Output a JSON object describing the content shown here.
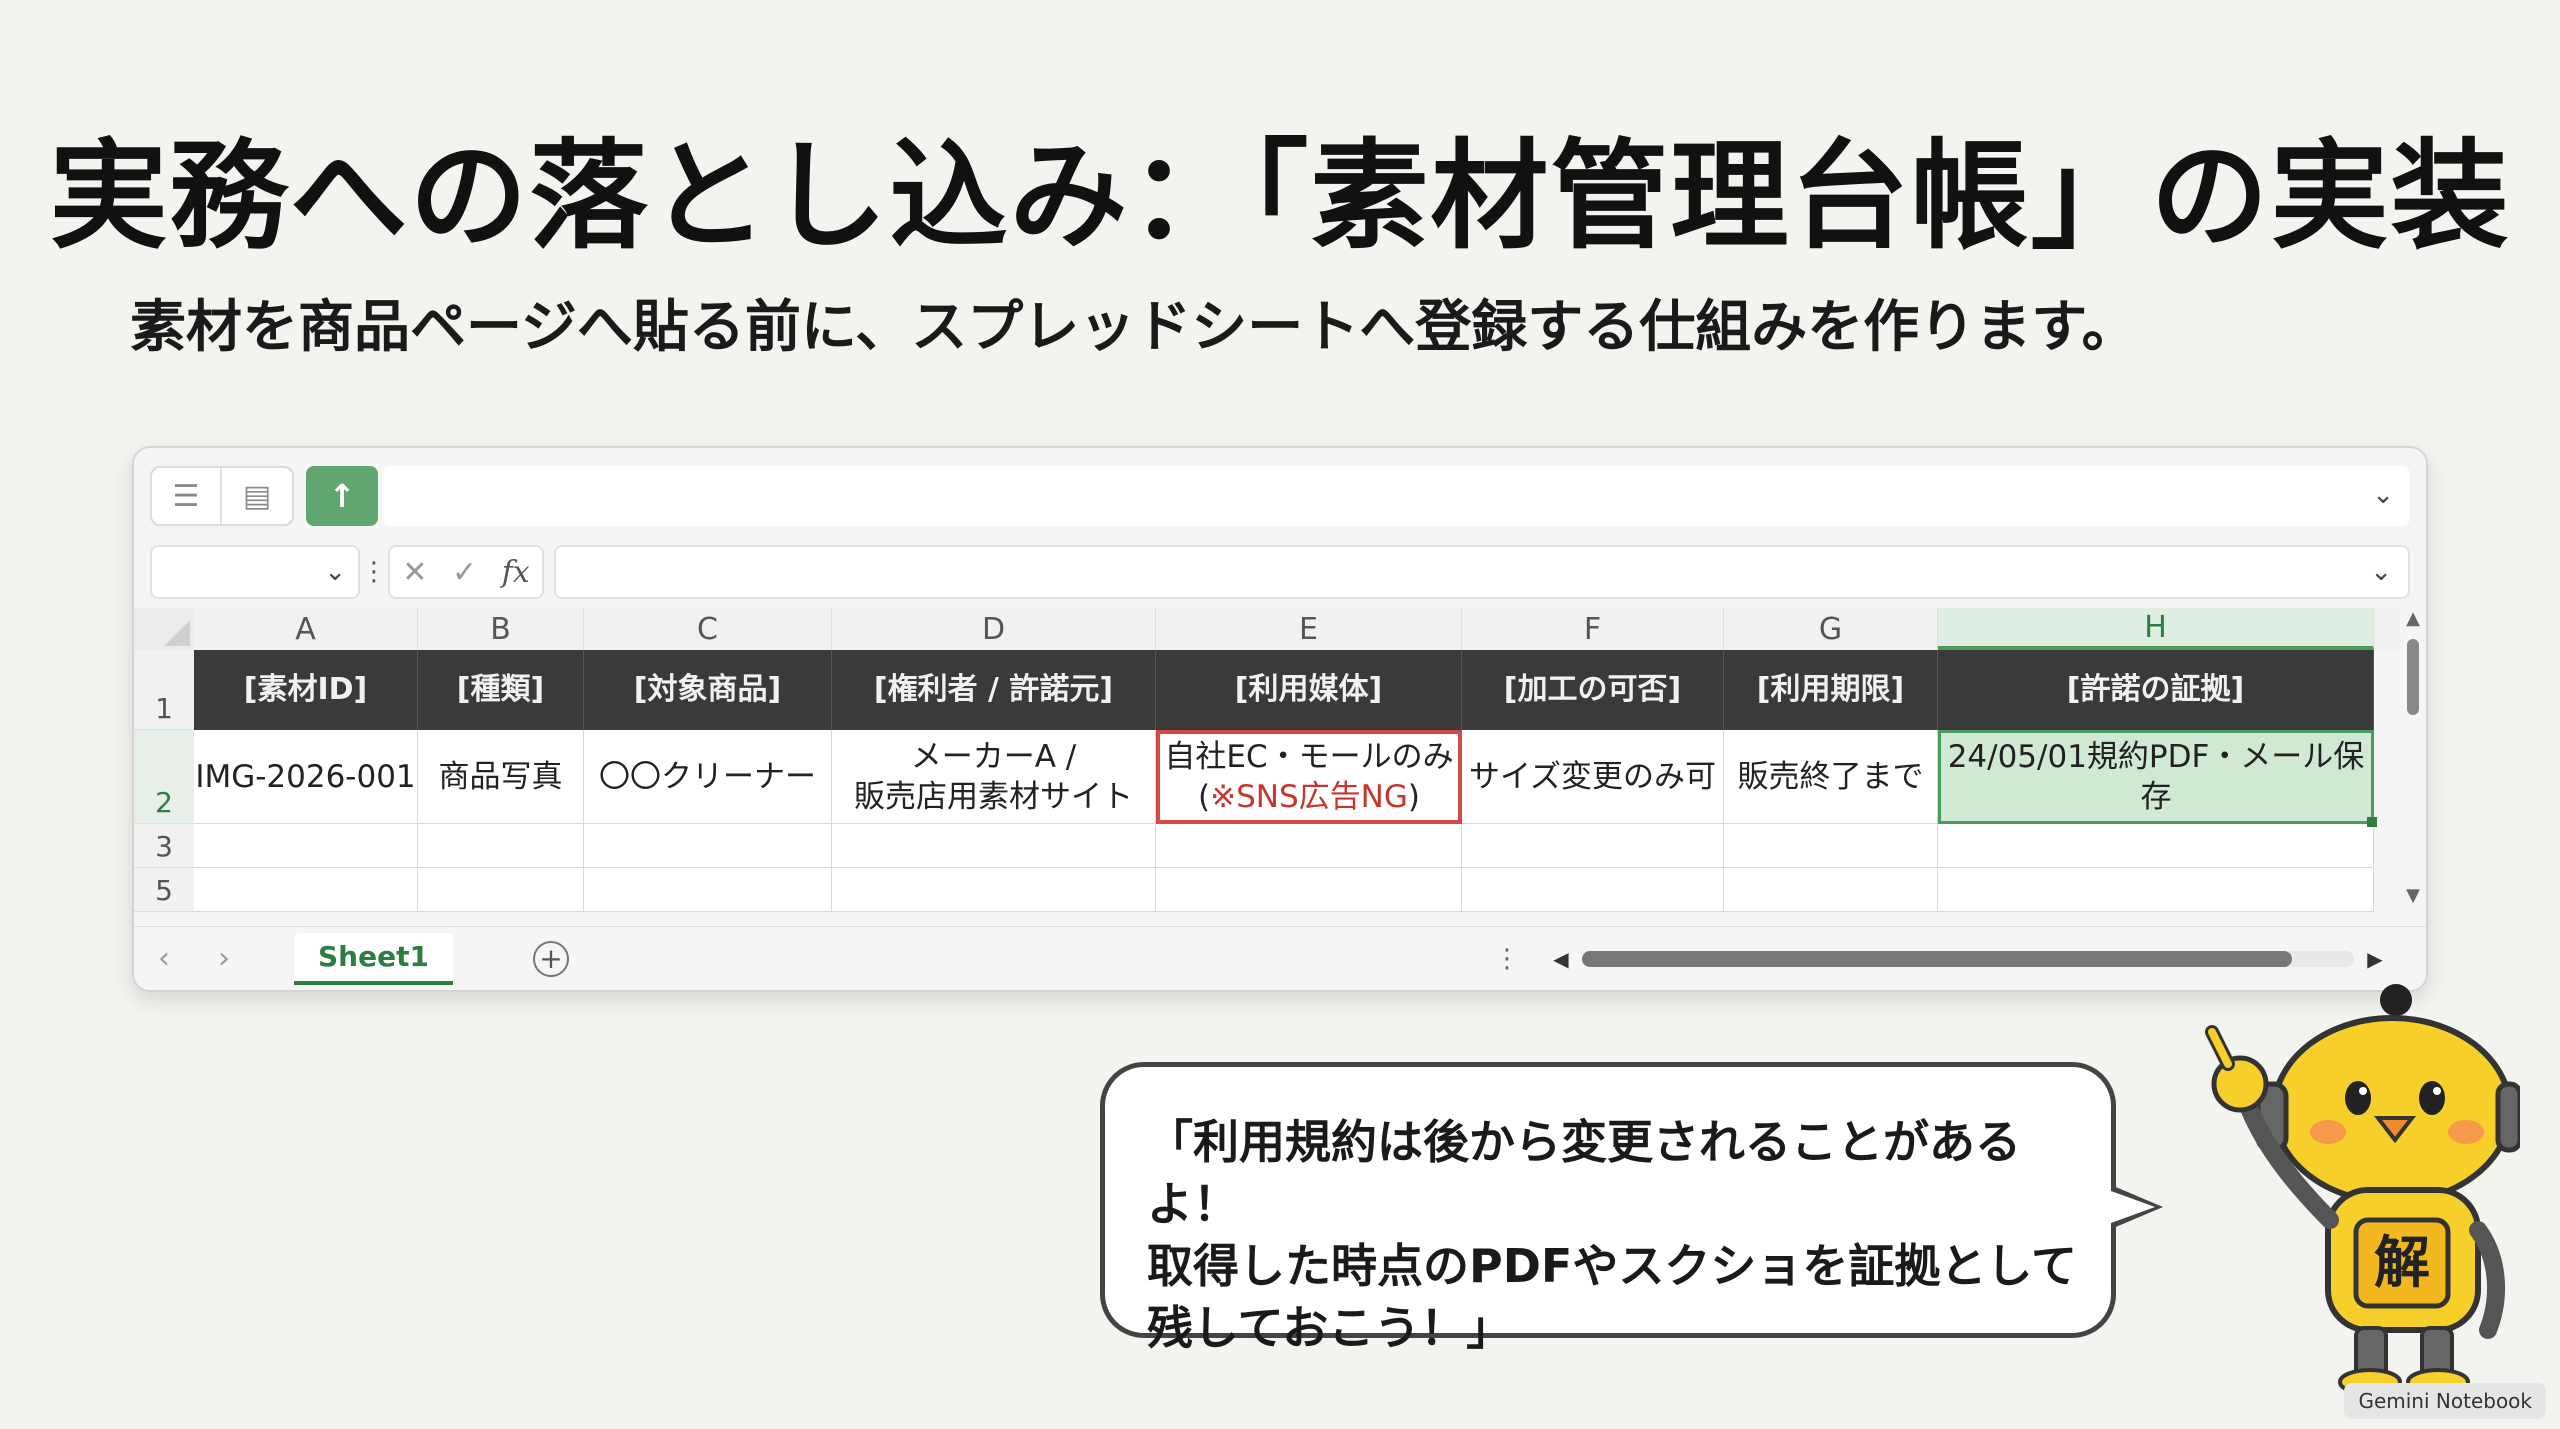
{
  "title": "実務への落とし込み：「素材管理台帳」の実装",
  "subtitle": "素材を商品ページへ貼る前に、スプレッドシートへ登録する仕組みを作ります。",
  "spreadsheet": {
    "toolbar": {
      "upload_icon": "↑"
    },
    "formula_bar": {
      "fx_label": "fx"
    },
    "columns": [
      "A",
      "B",
      "C",
      "D",
      "E",
      "F",
      "G",
      "H"
    ],
    "selected_column": "H",
    "headers": [
      "[素材ID]",
      "[種類]",
      "[対象商品]",
      "[権利者 / 許諾元]",
      "[利用媒体]",
      "[加工の可否]",
      "[利用期限]",
      "[許諾の証拠]"
    ],
    "row2": {
      "a": "IMG-2026-001",
      "b": "商品写真",
      "c": "〇〇クリーナー",
      "d": "メーカーA /\n販売店用素材サイト",
      "e_line1": "自社EC・モールのみ",
      "e_line2_open": "(",
      "e_line2_ng": "※SNS広告NG",
      "e_line2_close": ")",
      "f": "サイズ変更のみ可",
      "g": "販売終了まで",
      "h": "24/05/01規約PDF・メール保存"
    },
    "row_numbers": [
      "1",
      "2",
      "3",
      "5"
    ],
    "sheet_tab": "Sheet1"
  },
  "bubble": {
    "text": "「利用規約は後から変更されることがあるよ！\n取得した時点のPDFやスクショを証拠として\n残しておこう！」"
  },
  "mascot": {
    "badge": "解"
  },
  "watermark": "Gemini Notebook",
  "colors": {
    "accent_green": "#4a9b5c",
    "header_dark": "#3a3a3a",
    "warn_red": "#d24a43",
    "cell_green": "#cfe9d3"
  }
}
